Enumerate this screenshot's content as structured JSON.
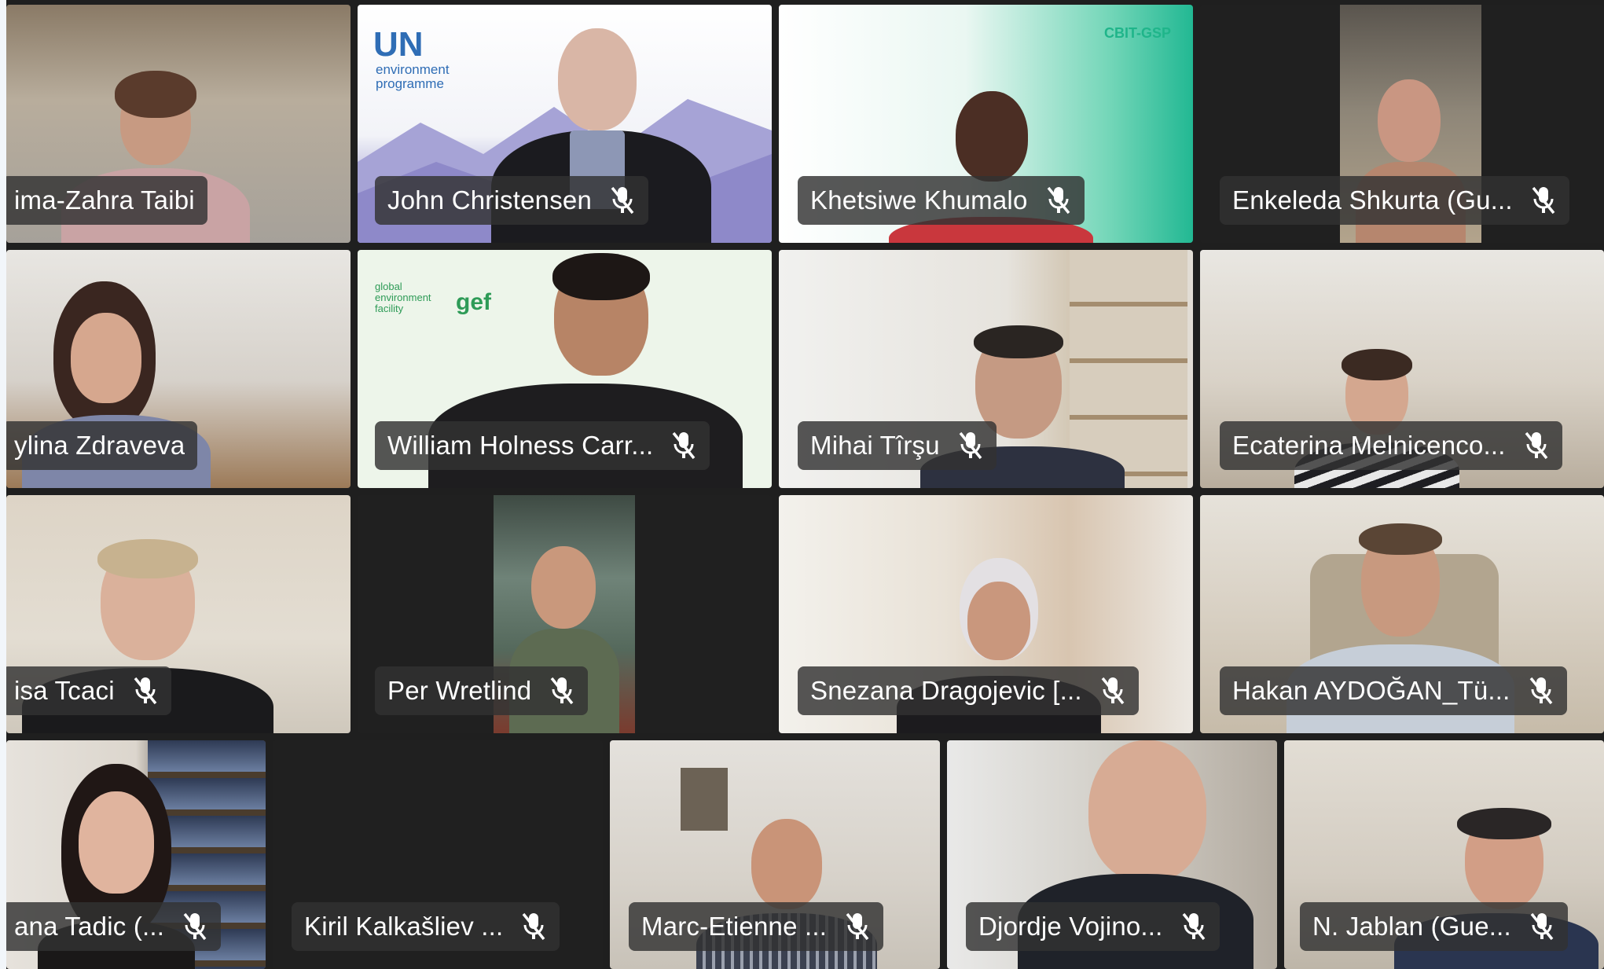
{
  "participants": [
    {
      "name": "ima-Zahra Taibi",
      "muted": false
    },
    {
      "name": "John Christensen",
      "muted": true
    },
    {
      "name": "Khetsiwe Khumalo",
      "muted": true
    },
    {
      "name": "Enkeleda Shkurta (Gu...",
      "muted": true
    },
    {
      "name": "ylina Zdraveva",
      "muted": false
    },
    {
      "name": "William Holness Carr...",
      "muted": true
    },
    {
      "name": "Mihai Tîrşu",
      "muted": true
    },
    {
      "name": "Ecaterina Melnicenco...",
      "muted": true
    },
    {
      "name": "isa Tcaci",
      "muted": true
    },
    {
      "name": "Per Wretlind",
      "muted": true
    },
    {
      "name": "Snezana Dragojevic [...",
      "muted": true
    },
    {
      "name": "Hakan AYDOĞAN_Tü...",
      "muted": true
    },
    {
      "name": "ana Tadic (...",
      "muted": true
    },
    {
      "name": "Kiril Kalkašliev ...",
      "muted": true
    },
    {
      "name": "Marc-Etienne ...",
      "muted": true
    },
    {
      "name": "Djordje Vojino...",
      "muted": true
    },
    {
      "name": "N. Jablan (Gue...",
      "muted": true
    }
  ],
  "backgrounds": {
    "un_logo": "UN",
    "un_sub": "environment\nprogramme",
    "cbit_logo": "CBIT-GSP",
    "gef_logo": "gef",
    "gef_sub": "global\nenvironment\nfacility"
  },
  "colors": {
    "nameplate_bg": "#323232",
    "grid_bg": "#1f1f1f",
    "un_blue": "#2f6db5",
    "gef_green": "#2e9b57",
    "cbit_teal": "#1fb58a"
  },
  "icons": {
    "mute": "microphone-off-icon"
  }
}
